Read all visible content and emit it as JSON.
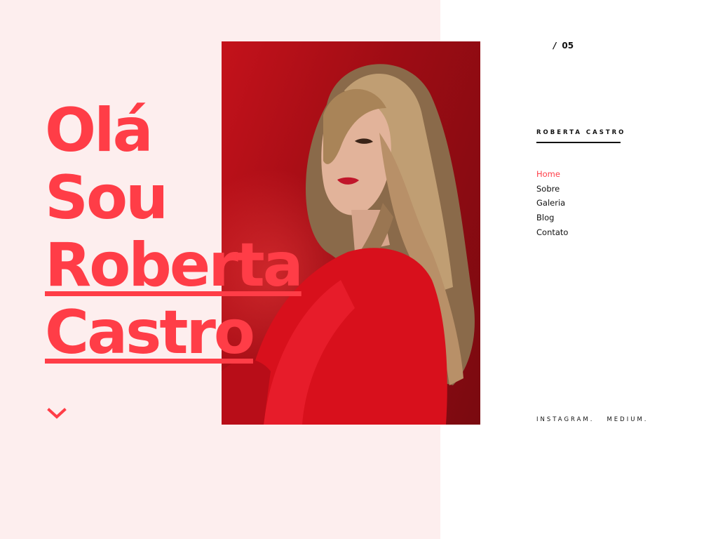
{
  "hero": {
    "line1": "Olá",
    "line2": "Sou",
    "line3": "Roberta",
    "line4": "Castro"
  },
  "pager": {
    "slash": "/",
    "page": "05"
  },
  "brand": {
    "name": "ROBERTA CASTRO"
  },
  "nav": {
    "items": [
      {
        "label": "Home",
        "active": true
      },
      {
        "label": "Sobre"
      },
      {
        "label": "Galeria"
      },
      {
        "label": "Blog"
      },
      {
        "label": "Contato"
      }
    ]
  },
  "social": {
    "instagram": "INSTAGRAM.",
    "medium": "MEDIUM."
  },
  "icons": {
    "scroll_down": "chevron-down-icon"
  },
  "colors": {
    "accent": "#ff3d47",
    "left_panel": "#fdeeee",
    "photo_bg": "#b3101a",
    "text": "#111111"
  }
}
